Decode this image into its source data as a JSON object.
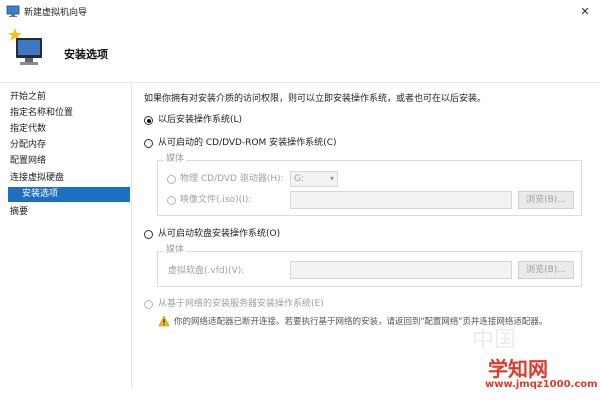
{
  "window": {
    "title": "新建虚拟机向导",
    "close_label": "✕"
  },
  "header": {
    "title": "安装选项"
  },
  "sidebar": {
    "items": [
      {
        "label": "开始之前"
      },
      {
        "label": "指定名称和位置"
      },
      {
        "label": "指定代数"
      },
      {
        "label": "分配内存"
      },
      {
        "label": "配置网络"
      },
      {
        "label": "连接虚拟硬盘"
      },
      {
        "label": "安装选项"
      },
      {
        "label": "摘要"
      }
    ],
    "active_index": 6
  },
  "main": {
    "intro": "如果你拥有对安装介质的访问权限，则可以立即安装操作系统，或者也可在以后安装。",
    "options": {
      "later": "以后安装操作系统(L)",
      "bootable_cd": "从可启动的 CD/DVD-ROM 安装操作系统(C)",
      "bootable_floppy": "从可启动软盘安装操作系统(O)",
      "network": "从基于网络的安装服务器安装操作系统(E)"
    },
    "cd_group": {
      "legend": "媒体",
      "physical_label": "物理 CD/DVD 驱动器(H):",
      "drive_value": "G:",
      "image_label": "映像文件(.iso)(I):",
      "image_value": "",
      "browse_label": "浏览(B)..."
    },
    "floppy_group": {
      "legend": "媒体",
      "vfd_label": "虚拟软盘(.vfd)(V):",
      "vfd_value": "",
      "browse_label": "浏览(B)..."
    },
    "warning": "你的网络适配器已断开连接。若要执行基于网络的安装，请返回到\"配置网络\"页并连接网络适配器。"
  },
  "watermark": {
    "site": "学知网",
    "url": "www.jmqz1000.com",
    "faint": "中国"
  },
  "colors": {
    "accent": "#1d6fbf",
    "watermark": "#e03a2b"
  },
  "icons": [
    "hyperv-app-icon",
    "monitor-wizard-icon",
    "close-icon",
    "warning-icon",
    "chevron-down-icon"
  ]
}
